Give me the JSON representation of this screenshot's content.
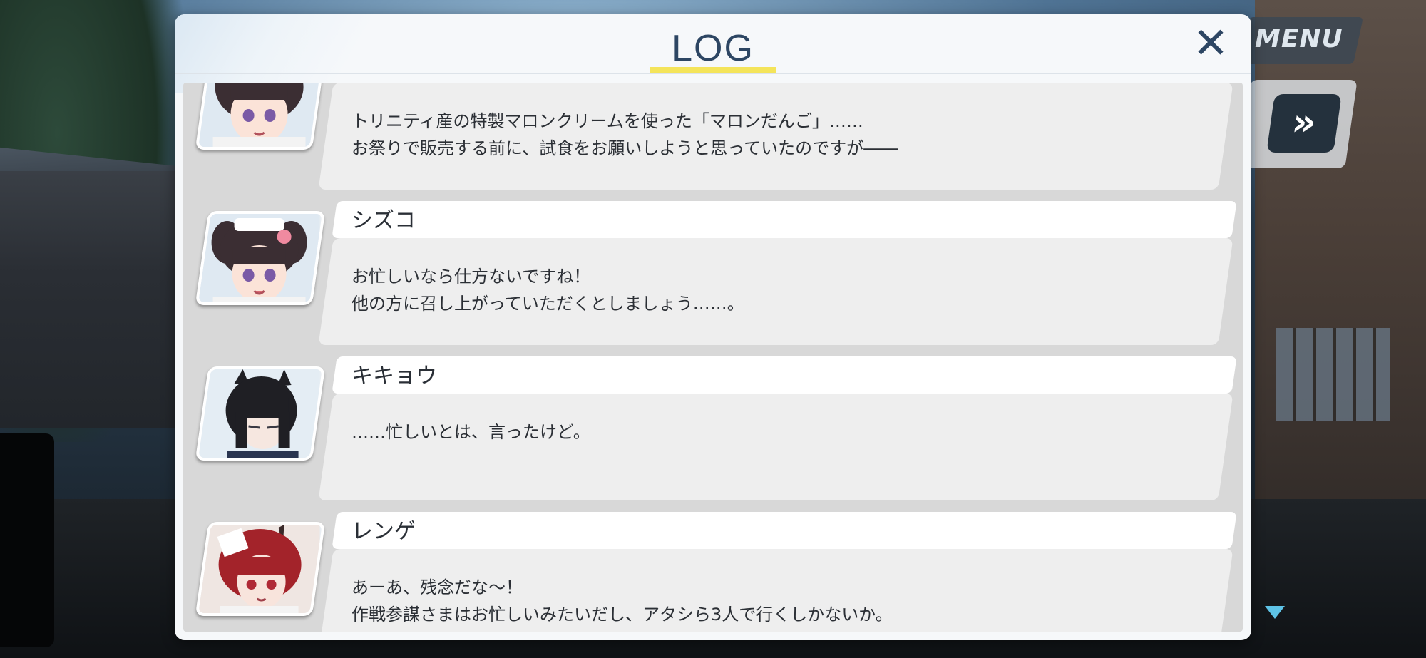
{
  "hud": {
    "menu_label": "MENU",
    "fast_forward_label": "»"
  },
  "log": {
    "title": "LOG",
    "close_label": "✕",
    "entries": [
      {
        "name": "",
        "avatar": "shizuko-portrait",
        "lines": [
          "トリニティ産の特製マロンクリームを使った「マロンだんご」……",
          "お祭りで販売する前に、試食をお願いしようと思っていたのですが――"
        ]
      },
      {
        "name": "シズコ",
        "avatar": "shizuko-portrait",
        "lines": [
          "お忙しいなら仕方ないですね！",
          "他の方に召し上がっていただくとしましょう……。"
        ]
      },
      {
        "name": "キキョウ",
        "avatar": "kikyou-portrait",
        "lines": [
          "……忙しいとは、言ったけど。"
        ]
      },
      {
        "name": "レンゲ",
        "avatar": "renge-portrait",
        "lines": [
          "あーあ、残念だな～！",
          "作戦参謀さまはお忙しいみたいだし、アタシら3人で行くしかないか。"
        ]
      }
    ]
  },
  "colors": {
    "title_text": "#2d4663",
    "underline_accent": "#f4e45a",
    "scroll_indicator": "#5ec3e6"
  }
}
